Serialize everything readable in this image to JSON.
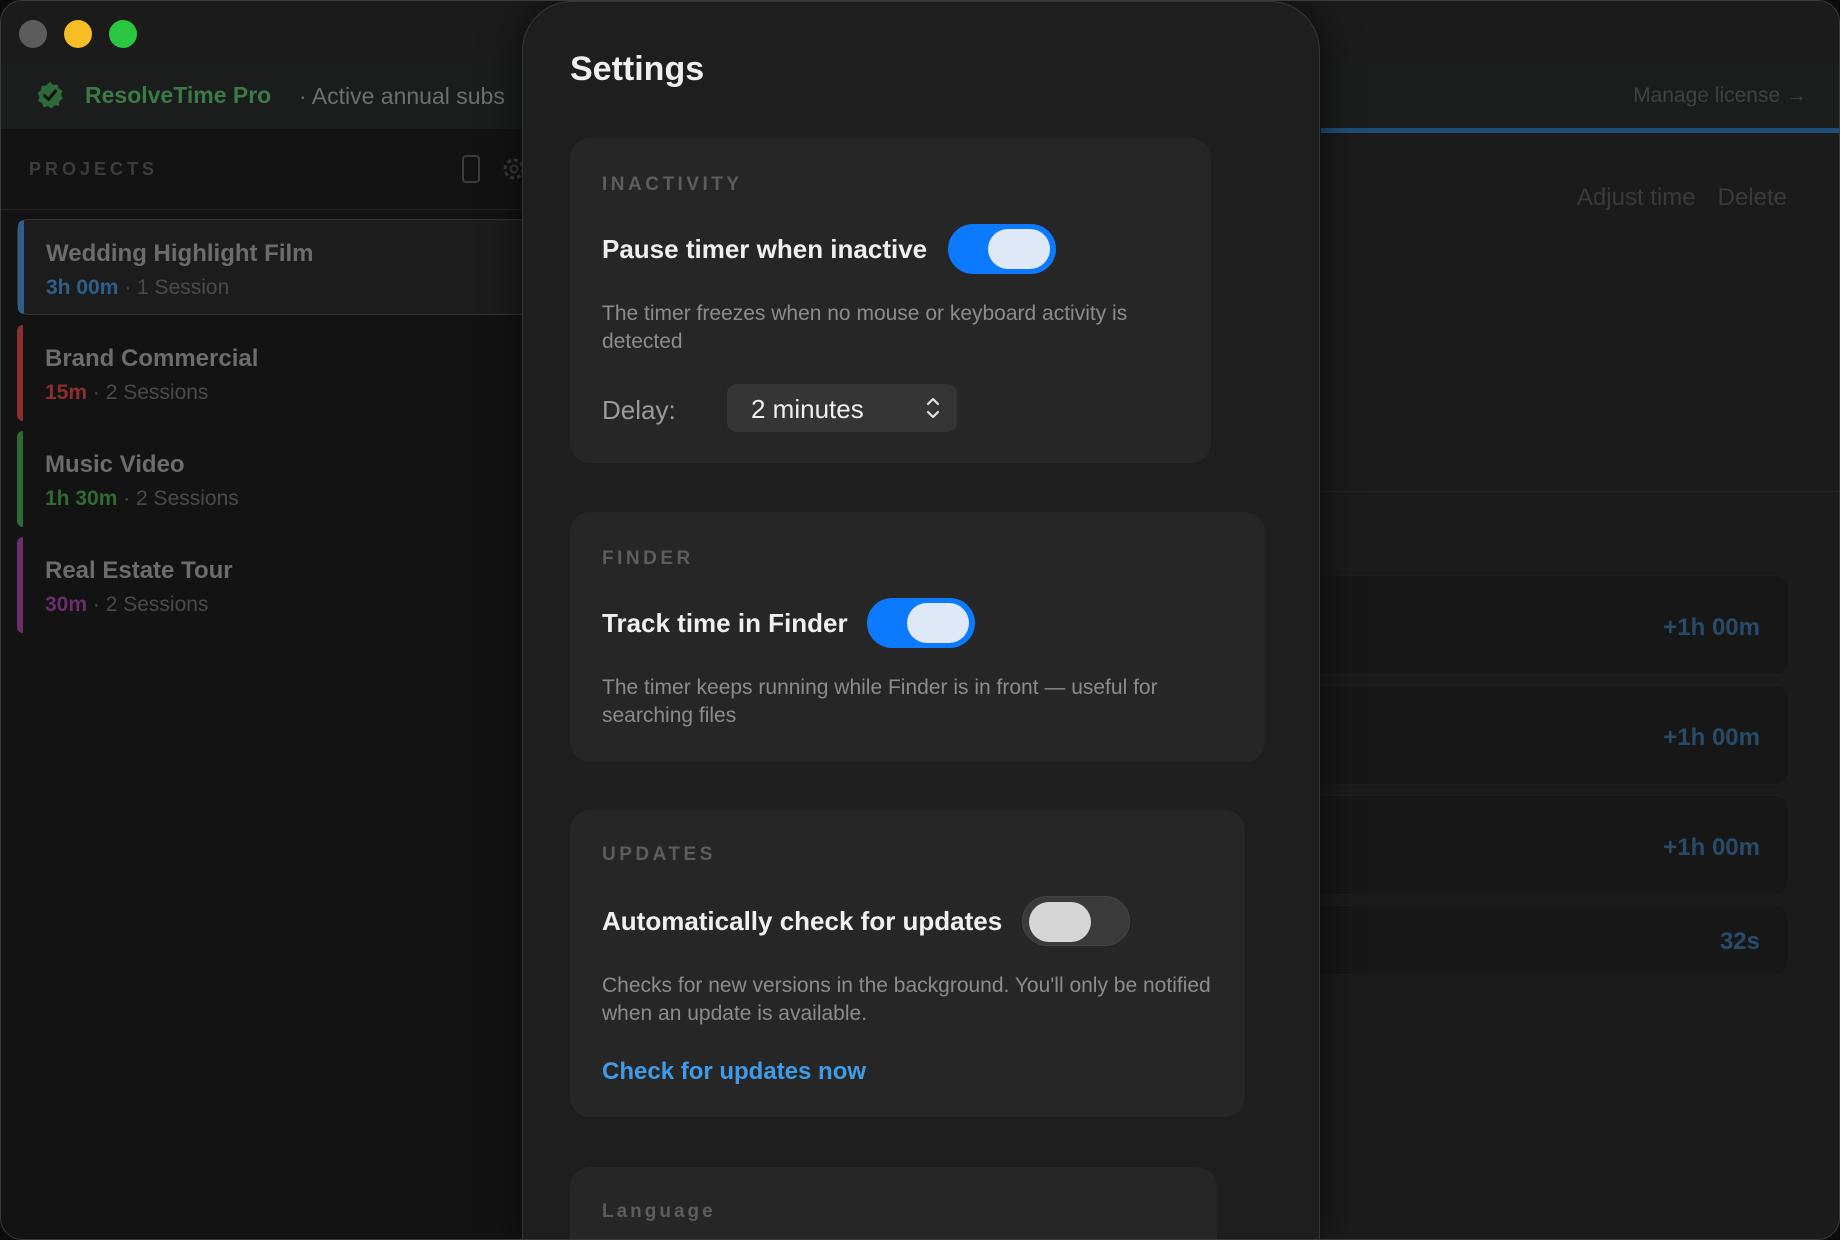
{
  "window": {
    "banner": {
      "app_name": "ResolveTime Pro",
      "status": "· Active annual subs",
      "manage_link": "Manage license →"
    }
  },
  "sidebar": {
    "header": "PROJECTS",
    "projects": [
      {
        "name": "Wedding Highlight Film",
        "duration": "3h 00m",
        "sessions": "· 1 Session",
        "color": "#2e5f8a",
        "selected": true
      },
      {
        "name": "Brand Commercial",
        "duration": "15m",
        "sessions": "· 2 Sessions",
        "color": "#8a2e2e",
        "selected": false
      },
      {
        "name": "Music Video",
        "duration": "1h 30m",
        "sessions": "· 2 Sessions",
        "color": "#2e6a34",
        "selected": false
      },
      {
        "name": "Real Estate Tour",
        "duration": "30m",
        "sessions": "· 2 Sessions",
        "color": "#6a2e6a",
        "selected": false
      }
    ]
  },
  "main": {
    "actions": {
      "adjust": "Adjust time",
      "delete": "Delete"
    },
    "sessions": [
      "+1h 00m",
      "+1h 00m",
      "+1h 00m",
      "32s"
    ]
  },
  "settings": {
    "title": "Settings",
    "inactivity": {
      "label": "INACTIVITY",
      "toggle_label": "Pause timer when inactive",
      "toggle_on": true,
      "description": "The timer freezes when no mouse or keyboard activity is detected",
      "delay_label": "Delay:",
      "delay_value": "2 minutes"
    },
    "finder": {
      "label": "FINDER",
      "toggle_label": "Track time in Finder",
      "toggle_on": true,
      "description": "The timer keeps running while Finder is in front — useful for searching files"
    },
    "updates": {
      "label": "UPDATES",
      "toggle_label": "Automatically check for updates",
      "toggle_on": false,
      "description": "Checks for new versions in the background. You'll only be notified when an update is available.",
      "check_link": "Check for updates now"
    },
    "language": {
      "label": "Language"
    }
  },
  "colors": {
    "accent_blue": "#0b7aff",
    "link_blue": "#3f9be6",
    "brand_green": "#3b7a47"
  }
}
